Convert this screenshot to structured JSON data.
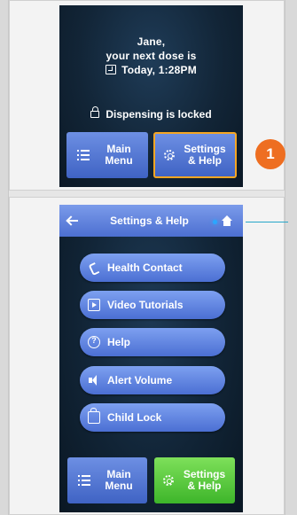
{
  "screen1": {
    "greeting_name": "Jane,",
    "next_dose_text": "your next dose is",
    "dose_time": "Today, 1:28PM",
    "dispensing_status": "Dispensing is locked",
    "main_menu_label_line1": "Main",
    "main_menu_label_line2": "Menu",
    "settings_label_line1": "Settings",
    "settings_label_line2": "& Help"
  },
  "step_badge": "1",
  "screen2": {
    "header_title": "Settings & Help",
    "menu_items": [
      {
        "label": "Health Contact",
        "icon": "phone-icon"
      },
      {
        "label": "Video Tutorials",
        "icon": "video-icon"
      },
      {
        "label": "Help",
        "icon": "help-icon"
      },
      {
        "label": "Alert Volume",
        "icon": "speaker-icon"
      },
      {
        "label": "Child Lock",
        "icon": "lock-icon"
      }
    ],
    "main_menu_label_line1": "Main",
    "main_menu_label_line2": "Menu",
    "settings_label_line1": "Settings",
    "settings_label_line2": "& Help"
  },
  "colors": {
    "accent_blue": "#4b6fd3",
    "highlight_orange": "#f5a623",
    "badge_orange": "#ee6e21",
    "active_green": "#3db52a",
    "callout_teal": "#27a7c9"
  }
}
